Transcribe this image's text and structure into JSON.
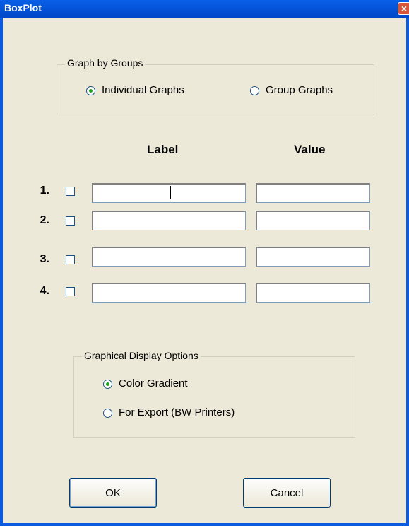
{
  "window": {
    "title": "BoxPlot",
    "close_glyph": "×"
  },
  "graph_by_groups": {
    "legend": "Graph by Groups",
    "options": [
      {
        "label": "Individual Graphs",
        "selected": true
      },
      {
        "label": "Group Graphs",
        "selected": false
      }
    ]
  },
  "columns": {
    "label": "Label",
    "value": "Value"
  },
  "rows": [
    {
      "number": "1.",
      "checked": false,
      "label_value": "",
      "value_value": ""
    },
    {
      "number": "2.",
      "checked": false,
      "label_value": "",
      "value_value": ""
    },
    {
      "number": "3.",
      "checked": false,
      "label_value": "",
      "value_value": ""
    },
    {
      "number": "4.",
      "checked": false,
      "label_value": "",
      "value_value": ""
    }
  ],
  "display_options": {
    "legend": "Graphical Display Options",
    "options": [
      {
        "label": "Color Gradient",
        "selected": true
      },
      {
        "label": "For Export (BW Printers)",
        "selected": false
      }
    ]
  },
  "buttons": {
    "ok": "OK",
    "cancel": "Cancel"
  },
  "colors": {
    "titlebar": "#0a5be0",
    "dialog_bg": "#ece9d8",
    "radio_dot": "#21a121",
    "close_button": "#d8553c"
  }
}
